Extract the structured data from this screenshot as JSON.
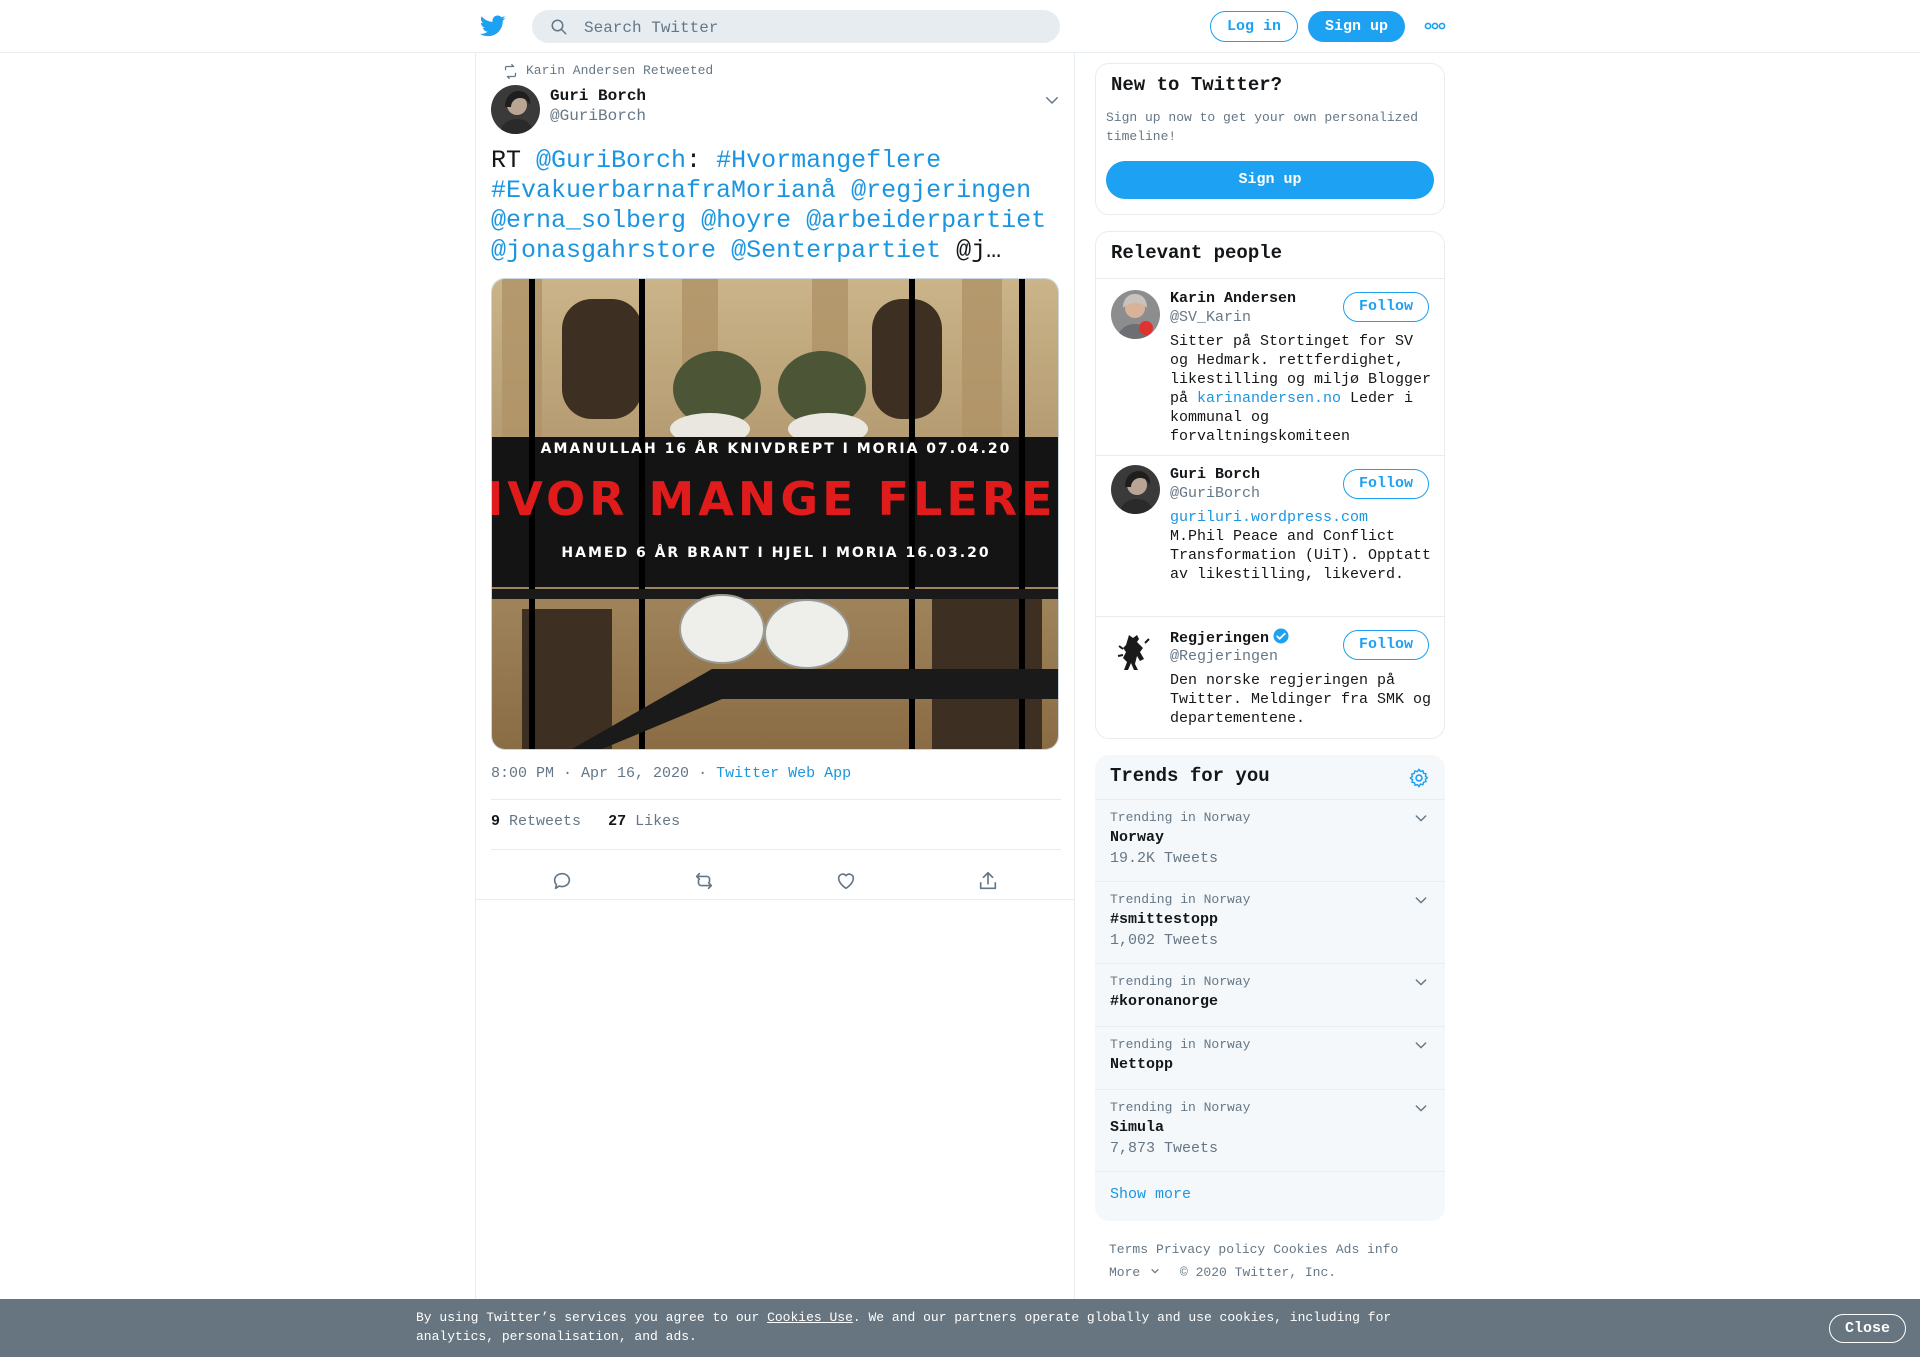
{
  "header": {
    "search_placeholder": "Search Twitter",
    "login_label": "Log in",
    "signup_label": "Sign up",
    "logo_icon": "twitter-bird-icon",
    "more_icon": "more-dots-icon"
  },
  "tweet": {
    "retweeted_by": "Karin Andersen Retweeted",
    "author_name": "Guri Borch",
    "author_handle": "@GuriBorch",
    "text_parts": {
      "p1": "RT ",
      "p2": "@GuriBorch",
      "p3": ": ",
      "p4": "#Hvormangeflere",
      "p5": "#EvakuerbarnafraMorianå",
      "p6": "@regjeringen",
      "p7": "@erna_solberg",
      "p8": "@hoyre",
      "p9": "@arbeiderpartiet",
      "p10": "@jonasgahrstore",
      "p11": "@Senterpartiet",
      "p12": " @j…"
    },
    "image": {
      "line1": "AMANULLAH 16 ÅR   KNIVDREPT I MORIA   07.04.20",
      "headline": "HVOR MANGE FLERE?",
      "line2": "HAMED 6 ÅR   BRANT I HJEL I MORIA   16.03.20"
    },
    "timestamp": "8:00 PM · Apr 16, 2020",
    "dot": "·",
    "source": "Twitter Web App",
    "retweets_count": "9",
    "retweets_label": "Retweets",
    "likes_count": "27",
    "likes_label": "Likes"
  },
  "sidebar": {
    "new": {
      "title": "New to Twitter?",
      "subtitle": "Sign up now to get your own personalized timeline!",
      "signup_label": "Sign up"
    },
    "people": {
      "title": "Relevant people",
      "follow_label": "Follow",
      "items": [
        {
          "name": "Karin Andersen",
          "handle": "@SV_Karin",
          "bio_a": "Sitter på Stortinget for SV og Hedmark. rettferdighet, likestilling og miljø Blogger på ",
          "bio_link": "karinandersen.no",
          "bio_b": " Leder i kommunal og forvaltningskomiteen"
        },
        {
          "name": "Guri Borch",
          "handle": "@GuriBorch",
          "bio_link": "guriluri.wordpress.com",
          "bio_b": "M.Phil Peace and Conflict Transformation (UiT). Opptatt av likestilling, likeverd."
        },
        {
          "name": "Regjeringen",
          "handle": "@Regjeringen",
          "bio_b": "Den norske regjeringen på Twitter. Meldinger fra SMK og departementene."
        }
      ]
    },
    "trends": {
      "title": "Trends for you",
      "items": [
        {
          "context": "Trending in Norway",
          "name": "Norway",
          "count": "19.2K Tweets"
        },
        {
          "context": "Trending in Norway",
          "name": "#smittestopp",
          "count": "1,002 Tweets"
        },
        {
          "context": "Trending in Norway",
          "name": "#koronanorge",
          "count": ""
        },
        {
          "context": "Trending in Norway",
          "name": "Nettopp",
          "count": ""
        },
        {
          "context": "Trending in Norway",
          "name": "Simula",
          "count": "7,873 Tweets"
        }
      ],
      "show_more": "Show more"
    },
    "footer": {
      "terms": "Terms",
      "privacy": "Privacy policy",
      "cookies": "Cookies",
      "ads": "Ads info",
      "more": "More",
      "copyright": "© 2020 Twitter, Inc."
    }
  },
  "cookie_banner": {
    "text_a": "By using Twitter’s services you agree to our ",
    "link": "Cookies Use",
    "text_b": ". We and our partners operate globally and use cookies, including for analytics, personalisation, and ads.",
    "close_label": "Close"
  },
  "colors": {
    "accent": "#1da1f2",
    "link": "#1b95e0",
    "muted": "#657786",
    "banner": "#66757f"
  }
}
